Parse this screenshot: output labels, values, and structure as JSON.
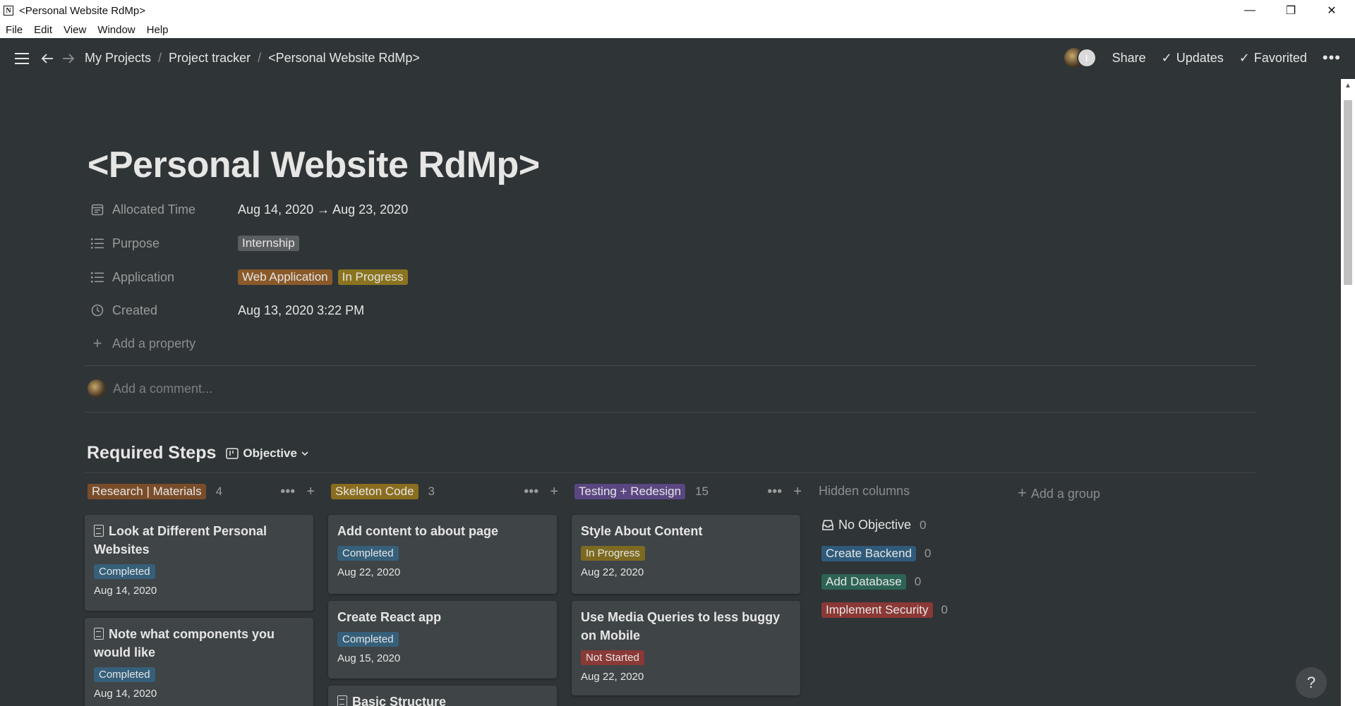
{
  "window": {
    "title": "<Personal Website RdMp>",
    "app_icon": "N",
    "controls": {
      "minimize": "—",
      "restore": "❐",
      "close": "✕"
    }
  },
  "menu": [
    "File",
    "Edit",
    "View",
    "Window",
    "Help"
  ],
  "nav": {
    "breadcrumbs": [
      "My Projects",
      "Project tracker",
      "<Personal Website RdMp>"
    ],
    "separator": "/",
    "avatar_letter": "I",
    "share": "Share",
    "updates": "Updates",
    "favorited": "Favorited"
  },
  "page": {
    "title": "<Personal Website RdMp>",
    "properties": {
      "allocated_time": {
        "name": "Allocated Time",
        "value": "Aug 14, 2020 → Aug 23, 2020"
      },
      "purpose": {
        "name": "Purpose",
        "tags": [
          "Internship"
        ]
      },
      "application": {
        "name": "Application",
        "tags": [
          "Web Application",
          "In Progress"
        ]
      },
      "created": {
        "name": "Created",
        "value": "Aug 13, 2020 3:22 PM"
      }
    },
    "add_property": "Add a property",
    "comment_placeholder": "Add a comment..."
  },
  "board": {
    "title": "Required Steps",
    "view": "Objective",
    "columns": [
      {
        "label": "Research | Materials",
        "count": "4",
        "color": "#7a4d2a",
        "cards": [
          {
            "title": "Look at Different Personal Websites",
            "status": "Completed",
            "date": "Aug 14, 2020"
          },
          {
            "title": "Note what components you would like",
            "status": "Completed",
            "date": "Aug 14, 2020"
          }
        ]
      },
      {
        "label": "Skeleton Code",
        "count": "3",
        "color": "#8a6d1f",
        "cards": [
          {
            "title": "Add content to about page",
            "status": "Completed",
            "date": "Aug 22, 2020"
          },
          {
            "title": "Create React app",
            "status": "Completed",
            "date": "Aug 15, 2020"
          },
          {
            "title": "Basic Structure",
            "status": "",
            "date": ""
          }
        ]
      },
      {
        "label": "Testing + Redesign",
        "count": "15",
        "color": "#5a4681",
        "cards": [
          {
            "title": "Style About Content",
            "status": "In Progress",
            "date": "Aug 22, 2020"
          },
          {
            "title": "Use Media Queries to less buggy on Mobile",
            "status": "Not Started",
            "date": "Aug 22, 2020"
          }
        ]
      }
    ],
    "hidden_columns": {
      "label": "Hidden columns",
      "items": [
        {
          "label": "No Objective",
          "count": "0",
          "color": ""
        },
        {
          "label": "Create Backend",
          "count": "0",
          "color": "#2f5a7a"
        },
        {
          "label": "Add Database",
          "count": "0",
          "color": "#2d6354"
        },
        {
          "label": "Implement Security",
          "count": "0",
          "color": "#8a3936"
        }
      ]
    },
    "add_group": "Add a group"
  },
  "status_colors": {
    "Completed": "#365f7a",
    "In Progress": "#7c6a21",
    "Not Started": "#8a3936"
  },
  "tag_colors": {
    "Internship": "#5a5e61",
    "Web Application": "#8a5a2a",
    "In Progress": "#8a7420"
  },
  "help": "?"
}
